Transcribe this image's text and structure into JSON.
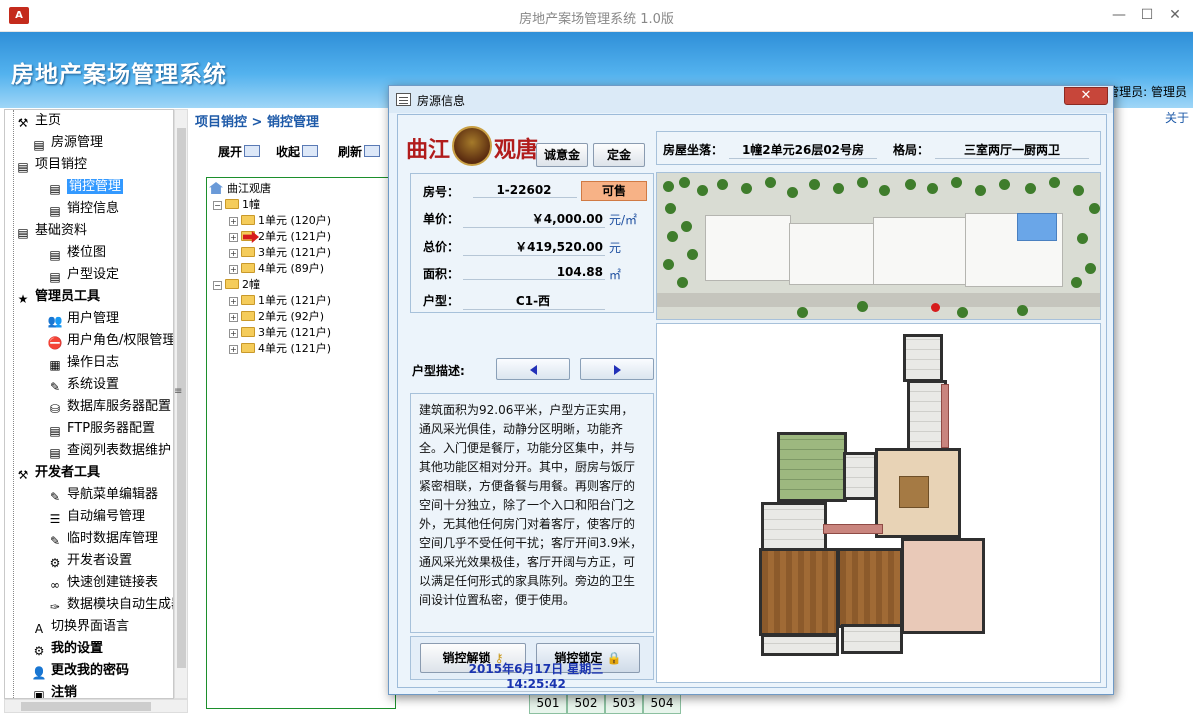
{
  "window": {
    "title": "房地产案场管理系统 1.0版",
    "app_icon": "A",
    "controls": {
      "minimize": "—",
      "maximize": "☐",
      "close": "✕"
    }
  },
  "banner": {
    "title": "房地产案场管理系统",
    "user_info": "管理员: 管理员"
  },
  "nav": {
    "items": [
      {
        "label": "主页",
        "icon": "tools-icon",
        "glyph": "⚒",
        "bold": false,
        "selected": false
      },
      {
        "label": "房源管理",
        "icon": "document-icon",
        "glyph": "▤",
        "bold": false,
        "selected": false
      },
      {
        "label": "项目销控",
        "icon": "document-icon",
        "glyph": "▤",
        "bold": false,
        "selected": false
      },
      {
        "label": "销控管理",
        "icon": "document-icon",
        "glyph": "▤",
        "bold": false,
        "selected": true
      },
      {
        "label": "销控信息",
        "icon": "document-icon",
        "glyph": "▤",
        "bold": false,
        "selected": false
      },
      {
        "label": "基础资料",
        "icon": "document-icon",
        "glyph": "▤",
        "bold": false,
        "selected": false
      },
      {
        "label": "楼位图",
        "icon": "document-icon",
        "glyph": "▤",
        "bold": false,
        "selected": false
      },
      {
        "label": "户型设定",
        "icon": "document-icon",
        "glyph": "▤",
        "bold": false,
        "selected": false
      },
      {
        "label": "管理员工具",
        "icon": "star-icon",
        "glyph": "★",
        "bold": true,
        "selected": false
      },
      {
        "label": "用户管理",
        "icon": "users-icon",
        "glyph": "👥",
        "bold": false,
        "selected": false
      },
      {
        "label": "用户角色/权限管理",
        "icon": "no-entry-icon",
        "glyph": "⛔",
        "bold": false,
        "selected": false
      },
      {
        "label": "操作日志",
        "icon": "log-icon",
        "glyph": "▦",
        "bold": false,
        "selected": false
      },
      {
        "label": "系统设置",
        "icon": "settings-doc-icon",
        "glyph": "✎",
        "bold": false,
        "selected": false
      },
      {
        "label": "数据库服务器配置",
        "icon": "database-icon",
        "glyph": "⛁",
        "bold": false,
        "selected": false
      },
      {
        "label": "FTP服务器配置",
        "icon": "ftp-icon",
        "glyph": "▤",
        "bold": false,
        "selected": false
      },
      {
        "label": "查阅列表数据维护",
        "icon": "list-icon",
        "glyph": "▤",
        "bold": false,
        "selected": false
      },
      {
        "label": "开发者工具",
        "icon": "tools-icon",
        "glyph": "⚒",
        "bold": true,
        "selected": false
      },
      {
        "label": "导航菜单编辑器",
        "icon": "editor-icon",
        "glyph": "✎",
        "bold": false,
        "selected": false
      },
      {
        "label": "自动编号管理",
        "icon": "numbered-list-icon",
        "glyph": "☰",
        "bold": false,
        "selected": false
      },
      {
        "label": "临时数据库管理",
        "icon": "temp-db-icon",
        "glyph": "✎",
        "bold": false,
        "selected": false
      },
      {
        "label": "开发者设置",
        "icon": "gears-icon",
        "glyph": "⚙",
        "bold": false,
        "selected": false
      },
      {
        "label": "快速创建链接表",
        "icon": "link-icon",
        "glyph": "∞",
        "bold": false,
        "selected": false
      },
      {
        "label": "数据模块自动生成器",
        "icon": "wand-icon",
        "glyph": "✑",
        "bold": false,
        "selected": false
      },
      {
        "label": "切换界面语言",
        "icon": "language-icon",
        "glyph": "A",
        "bold": false,
        "selected": false
      },
      {
        "label": "我的设置",
        "icon": "my-settings-icon",
        "glyph": "⚙",
        "bold": true,
        "selected": false
      },
      {
        "label": "更改我的密码",
        "icon": "user-key-icon",
        "glyph": "👤",
        "bold": true,
        "selected": false
      },
      {
        "label": "注销",
        "icon": "logout-icon",
        "glyph": "▣",
        "bold": true,
        "selected": false
      }
    ]
  },
  "main": {
    "breadcrumb": "项目销控 > 销控管理",
    "about": "关于",
    "toolbar": {
      "expand": "展开",
      "collapse": "收起",
      "refresh": "刷新"
    },
    "tree": {
      "root": "曲江观唐",
      "buildings": [
        {
          "name": "1幢",
          "units": [
            "1单元 (120户)",
            "2单元 (121户)",
            "3单元 (121户)",
            "4单元 (89户)"
          ]
        },
        {
          "name": "2幢",
          "units": [
            "1单元 (121户)",
            "2单元 (92户)",
            "3单元 (121户)",
            "4单元 (121户)"
          ]
        }
      ]
    },
    "room_numbers": [
      "501",
      "502",
      "503",
      "504"
    ]
  },
  "dialog": {
    "title": "房源信息",
    "close": "✕",
    "logo": {
      "left": "曲江",
      "right": "观唐"
    },
    "deposit_intent_button": "诚意金",
    "deposit_button": "定金",
    "location_label": "房屋坐落：",
    "location_value": "1幢2单元26层02号房",
    "layout_label": "格局：",
    "layout_value": "三室两厅一厨两卫",
    "fields": {
      "room_no_label": "房号：",
      "room_no": "1-22602",
      "status": "可售",
      "unit_price_label": "单价：",
      "unit_price": "￥4,000.00",
      "unit_price_unit": "元/㎡",
      "total_price_label": "总价：",
      "total_price": "￥419,520.00",
      "total_price_unit": "元",
      "area_label": "面积：",
      "area": "104.88",
      "area_unit": "㎡",
      "type_label": "户型：",
      "type": "C1-西"
    },
    "desc_label": "户型描述:",
    "description": "建筑面积为92.06平米，户型方正实用，通风采光俱佳，动静分区明晰，功能齐全。入门便是餐厅，功能分区集中，并与其他功能区相对分开。其中，厨房与饭厅紧密相联，方便备餐与用餐。再则客厅的空间十分独立，除了一个入口和阳台门之外，无其他任何房门对着客厅，使客厅的空间几乎不受任何干扰；客厅开间3.9米，通风采光效果极佳，客厅开阔与方正，可以满足任何形式的家具陈列。旁边的卫生间设计位置私密，便于使用。",
    "unlock_button": "销控解锁",
    "lock_button": "销控锁定",
    "datetime": "2015年6月17日 星期三 14:25:42"
  },
  "colors": {
    "banner": "#2f8fd8",
    "accent": "#1e5aa8",
    "status": "#f7b286",
    "selected": "#3399ff"
  }
}
